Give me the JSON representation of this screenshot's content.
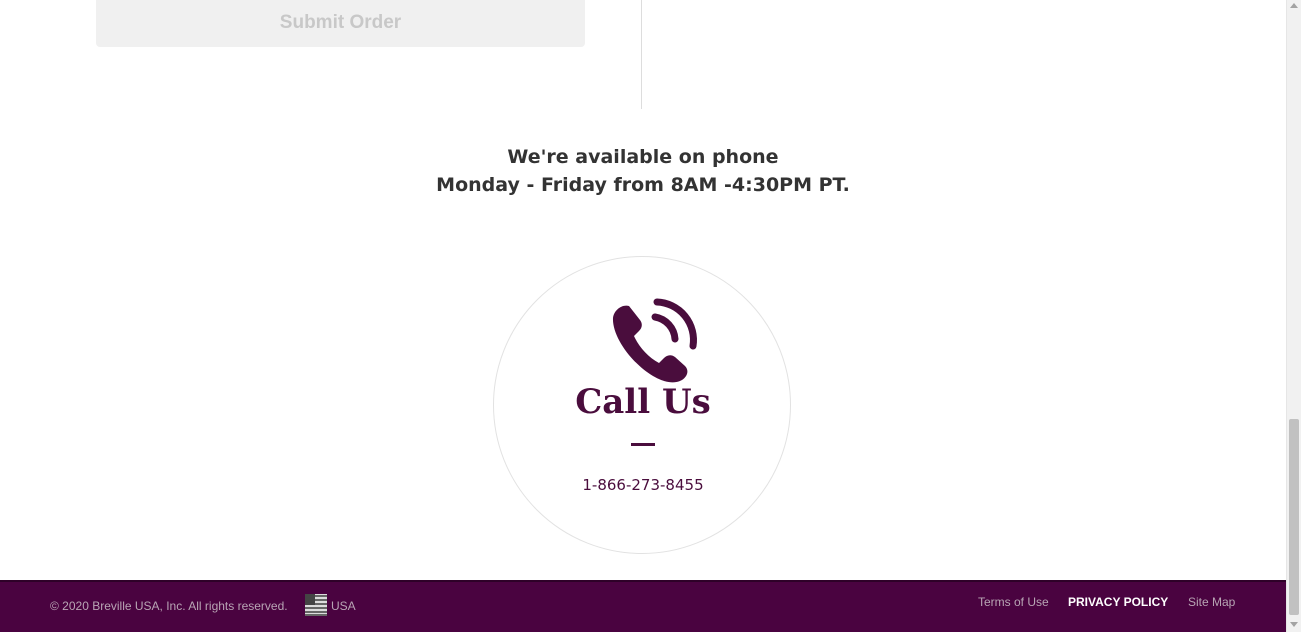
{
  "order": {
    "submit_label": "Submit Order"
  },
  "availability": {
    "line1": "We're available on phone",
    "line2": "Monday - Friday from 8AM -4:30PM PT."
  },
  "call": {
    "icon": "phone-icon",
    "title": "Call Us",
    "phone": "1-866-273-8455",
    "accent_color": "#4a0d3d"
  },
  "footer": {
    "copyright": "© 2020 Breville USA, Inc. All rights reserved.",
    "country_flag_icon": "us-flag-icon",
    "country": "USA",
    "links": {
      "terms": "Terms of Use",
      "privacy": "PRIVACY POLICY",
      "sitemap": "Site Map"
    },
    "background_color": "#4a0340"
  }
}
